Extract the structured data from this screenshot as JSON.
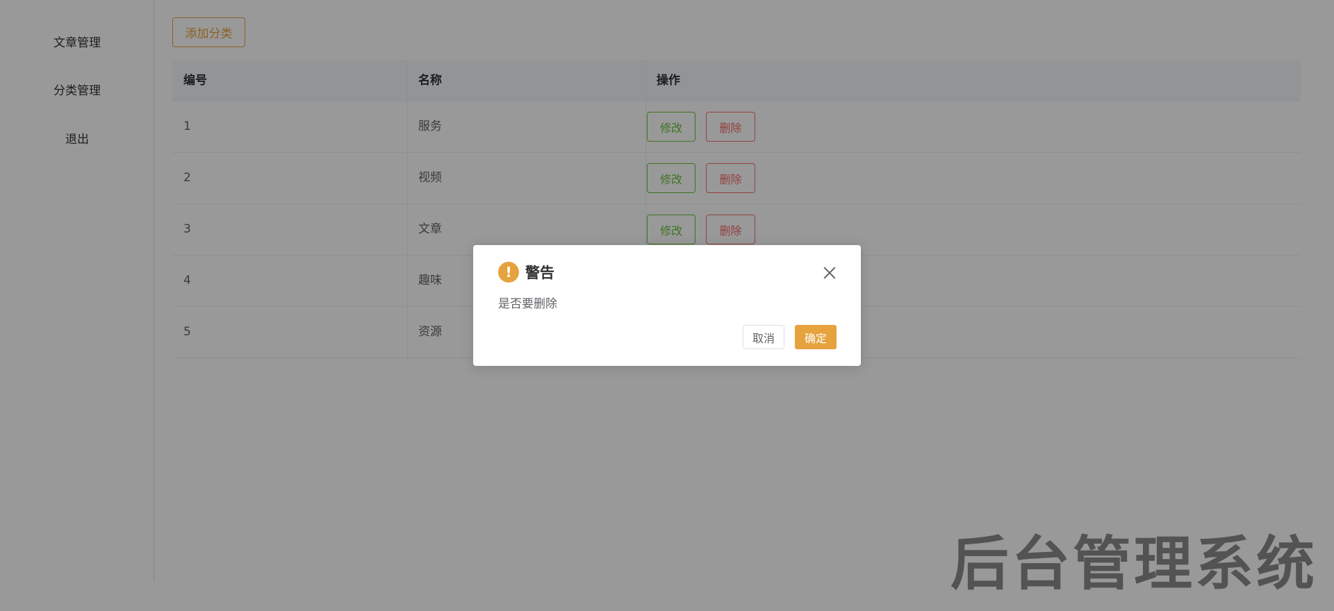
{
  "sidebar": {
    "items": [
      {
        "label": "文章管理"
      },
      {
        "label": "分类管理"
      },
      {
        "label": "退出"
      }
    ]
  },
  "toolbar": {
    "add_label": "添加分类"
  },
  "table": {
    "columns": [
      "编号",
      "名称",
      "操作"
    ],
    "rows": [
      {
        "id": "1",
        "name": "服务"
      },
      {
        "id": "2",
        "name": "视频"
      },
      {
        "id": "3",
        "name": "文章"
      },
      {
        "id": "4",
        "name": "趣味"
      },
      {
        "id": "5",
        "name": "资源"
      }
    ],
    "edit_label": "修改",
    "delete_label": "删除"
  },
  "watermark": "后台管理系统",
  "dialog": {
    "icon_text": "!",
    "title": "警告",
    "message": "是否要删除",
    "cancel_label": "取消",
    "confirm_label": "确定"
  },
  "colors": {
    "warning": "#e6a23c",
    "success": "#67c23a",
    "danger": "#f56c6c"
  }
}
